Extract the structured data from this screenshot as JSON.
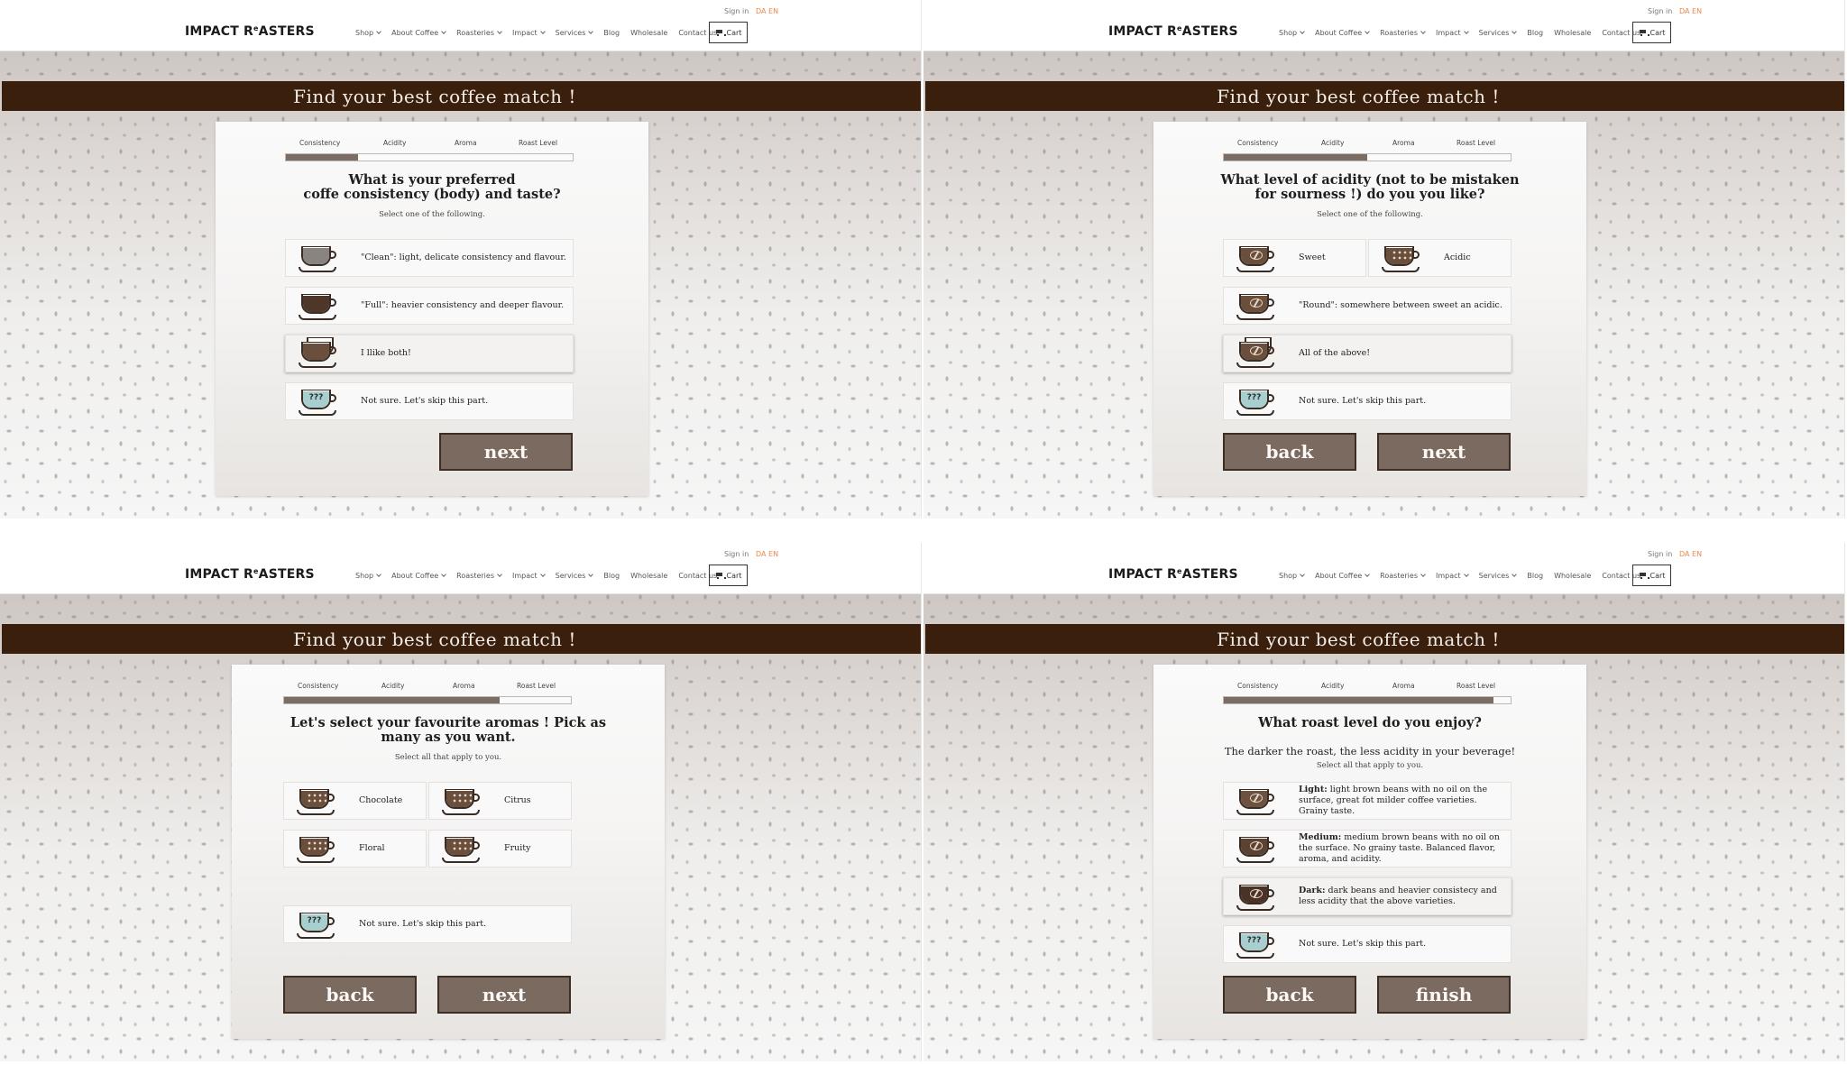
{
  "header": {
    "logo": "IMPACT R",
    "logo_sup": "e",
    "logo_rest": "ASTERS",
    "nav": [
      "Shop",
      "About Coffee",
      "Roasteries",
      "Impact",
      "Services",
      "Blog",
      "Wholesale",
      "Contact us"
    ],
    "nav_has_caret": [
      true,
      true,
      true,
      true,
      true,
      false,
      false,
      false
    ],
    "signin": "Sign in",
    "lang": "DA EN",
    "cart": "Cart"
  },
  "banner_title": "Find your best coffee match !",
  "steps": [
    "Consistency",
    "Acidity",
    "Aroma",
    "Roast Level"
  ],
  "colors": {
    "banner": "#3a1f0d",
    "button": "#7b6a5f",
    "progress": "#7b6d63",
    "lang": "#e88b4a"
  },
  "panels": [
    {
      "progress_fraction": 0.25,
      "question": [
        "What is your preferred",
        "coffe consistency (body) and taste?"
      ],
      "hint": "Select one of the following.",
      "options": [
        {
          "text": "\"Clean\": light, delicate consistency and flavour.",
          "icon": "clean-cup-icon"
        },
        {
          "text": "\"Full\": heavier consistency and deeper flavour.",
          "icon": "full-cup-icon"
        },
        {
          "text": "I llike both!",
          "icon": "double-cup-icon",
          "selected": true
        },
        {
          "text": "Not sure. Let's skip this part.",
          "icon": "unknown-cup-icon",
          "mark": "???"
        }
      ],
      "buttons": [
        "next"
      ]
    },
    {
      "progress_fraction": 0.5,
      "question": [
        "What level of acidity (not to be mistaken",
        "for sourness !) do you you like?"
      ],
      "hint": "Select one of the following.",
      "options": [
        {
          "text": "Sweet",
          "icon": "sweet-cup-icon"
        },
        {
          "text": "Acidic",
          "icon": "acidic-cup-icon"
        },
        {
          "text": "\"Round\": somewhere between sweet an acidic.",
          "icon": "round-cup-icon"
        },
        {
          "text": "All of the above!",
          "icon": "all-cups-icon",
          "selected": true
        },
        {
          "text": "Not sure. Let's skip this part.",
          "icon": "unknown-cup-icon",
          "mark": "???"
        }
      ],
      "buttons": [
        "back",
        "next"
      ]
    },
    {
      "progress_fraction": 0.75,
      "question": [
        "Let's select your favourite aromas ! Pick as",
        "many as you want."
      ],
      "hint": "Select all that apply to you.",
      "options": [
        {
          "text": "Chocolate",
          "icon": "chocolate-cup-icon"
        },
        {
          "text": "Citrus",
          "icon": "citrus-cup-icon"
        },
        {
          "text": "Floral",
          "icon": "floral-cup-icon"
        },
        {
          "text": "Fruity",
          "icon": "fruity-cup-icon"
        },
        {
          "text": "Not sure. Let's skip this part.",
          "icon": "unknown-cup-icon",
          "mark": "???"
        }
      ],
      "buttons": [
        "back",
        "next"
      ]
    },
    {
      "progress_fraction": 0.94,
      "question": [
        "What roast level do you enjoy?"
      ],
      "subq": "The darker the roast, the less acidity in your beverage!",
      "hint": "Select all that apply to you.",
      "options": [
        {
          "bold": "Light:",
          "text": " light brown beans with no oil on the surface, great fot milder coffee varieties. Grainy taste.",
          "icon": "light-roast-cup-icon"
        },
        {
          "bold": "Medium:",
          "text": " medium brown beans with no oil on the surface. No grainy taste. Balanced flavor, aroma, and acidity.",
          "icon": "medium-roast-cup-icon"
        },
        {
          "bold": "Dark:",
          "text": " dark beans and heavier consistecy and less acidity that the above varieties.",
          "icon": "dark-roast-cup-icon",
          "selected": true
        },
        {
          "text": "Not sure. Let's skip this part.",
          "icon": "unknown-cup-icon",
          "mark": "???"
        }
      ],
      "buttons": [
        "back",
        "finish"
      ]
    }
  ]
}
